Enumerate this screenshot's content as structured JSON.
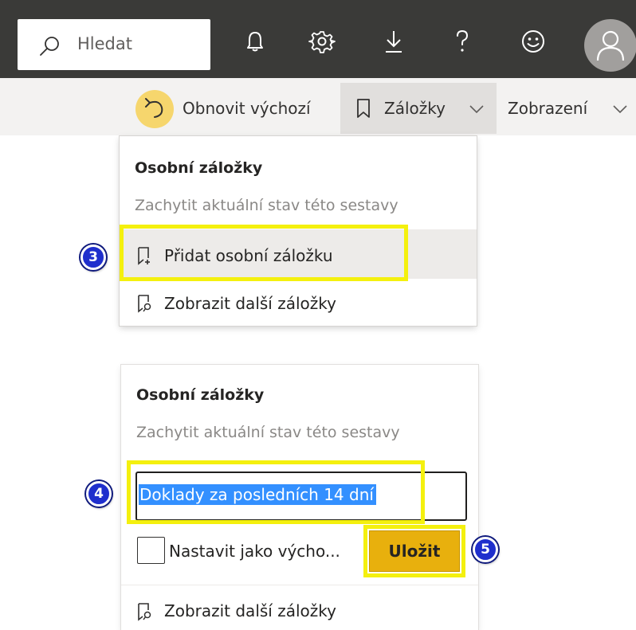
{
  "topbar": {
    "search_placeholder": "Hledat",
    "icons": [
      "bell-icon",
      "gear-icon",
      "download-icon",
      "help-icon",
      "smiley-icon",
      "avatar-icon"
    ]
  },
  "commandbar": {
    "reset_label": "Obnovit výchozí",
    "bookmarks_label": "Záložky",
    "view_label": "Zobrazení"
  },
  "panel1": {
    "title": "Osobní záložky",
    "subtitle": "Zachytit aktuální stav této sestavy",
    "add_label": "Přidat osobní záložku",
    "more_label": "Zobrazit další záložky"
  },
  "panel2": {
    "title": "Osobní záložky",
    "subtitle": "Zachytit aktuální stav této sestavy",
    "name_value": "Doklady za posledních 14 dní",
    "default_checkbox_label": "Nastavit jako výcho...",
    "save_label": "Uložit",
    "more_label": "Zobrazit další záložky"
  },
  "callouts": {
    "step3": "3",
    "step4": "4",
    "step5": "5"
  },
  "colors": {
    "topbar_bg": "#3a3a38",
    "reset_highlight": "#f6d66d",
    "callout_border": "#f4f00e",
    "badge_blue": "#1f2fcd",
    "save_button": "#e8b00d",
    "selection_blue": "#3390ff"
  }
}
